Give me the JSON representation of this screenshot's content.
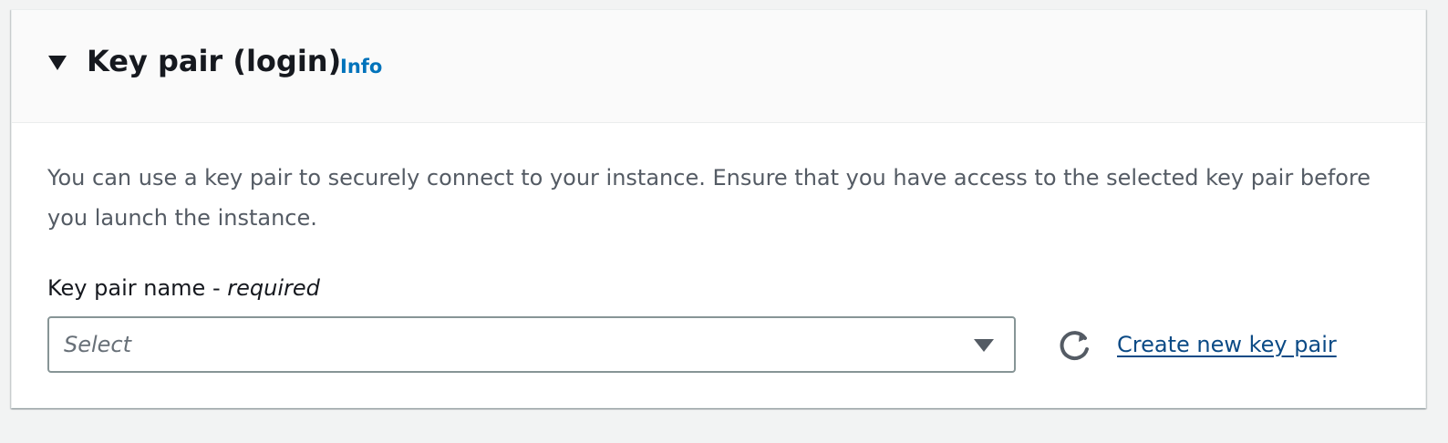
{
  "section": {
    "title": "Key pair (login)",
    "info_label": "Info",
    "description": "You can use a key pair to securely connect to your instance. Ensure that you have access to the selected key pair before you launch the instance."
  },
  "key_pair_field": {
    "label": "Key pair name - ",
    "required_label": "required",
    "placeholder": "Select",
    "refresh_icon": "refresh-icon",
    "create_link_label": "Create new key pair"
  },
  "colors": {
    "link": "#0073bb",
    "create_link": "#0b4a85",
    "text": "#16191f",
    "description_text": "#545b64",
    "header_bg": "#fafafa",
    "page_bg": "#f2f3f3"
  }
}
